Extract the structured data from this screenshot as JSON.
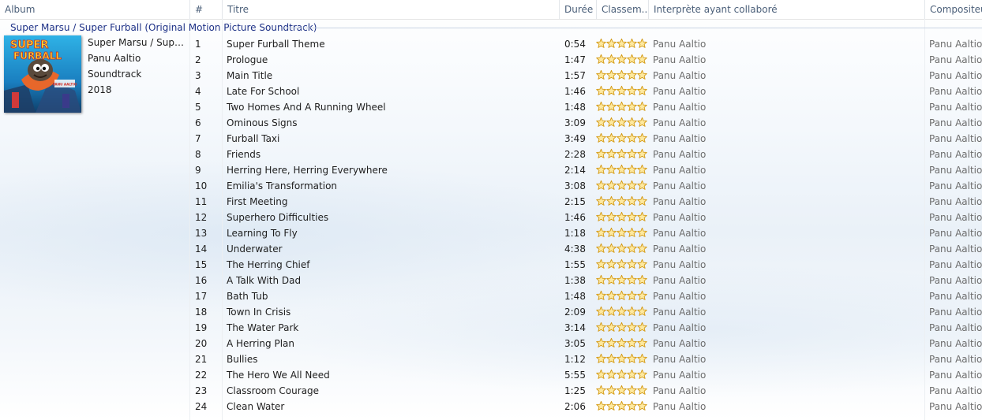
{
  "columns": {
    "album": "Album",
    "num": "#",
    "title": "Titre",
    "duration": "Durée",
    "rating": "Classem...",
    "artist": "Interprète ayant collaboré",
    "composer": "Compositeur"
  },
  "group": {
    "title": "Super Marsu / Super Furball (Original Motion Picture Soundtrack)",
    "album_short": "Super Marsu / Super F...",
    "artist": "Panu Aaltio",
    "genre": "Soundtrack",
    "year": "2018"
  },
  "cover": {
    "text1": "SUPER",
    "text2": "FURBALL",
    "credit": "PANU AALTIO"
  },
  "tracks": [
    {
      "num": "1",
      "title": "Super Furball Theme",
      "duration": "0:54",
      "artist": "Panu Aaltio",
      "composer": "Panu Aaltio"
    },
    {
      "num": "2",
      "title": "Prologue",
      "duration": "1:47",
      "artist": "Panu Aaltio",
      "composer": "Panu Aaltio"
    },
    {
      "num": "3",
      "title": "Main Title",
      "duration": "1:57",
      "artist": "Panu Aaltio",
      "composer": "Panu Aaltio"
    },
    {
      "num": "4",
      "title": "Late For School",
      "duration": "1:46",
      "artist": "Panu Aaltio",
      "composer": "Panu Aaltio"
    },
    {
      "num": "5",
      "title": "Two Homes And A Running Wheel",
      "duration": "1:48",
      "artist": "Panu Aaltio",
      "composer": "Panu Aaltio"
    },
    {
      "num": "6",
      "title": "Ominous Signs",
      "duration": "3:09",
      "artist": "Panu Aaltio",
      "composer": "Panu Aaltio"
    },
    {
      "num": "7",
      "title": "Furball Taxi",
      "duration": "3:49",
      "artist": "Panu Aaltio",
      "composer": "Panu Aaltio"
    },
    {
      "num": "8",
      "title": "Friends",
      "duration": "2:28",
      "artist": "Panu Aaltio",
      "composer": "Panu Aaltio"
    },
    {
      "num": "9",
      "title": "Herring Here, Herring Everywhere",
      "duration": "2:14",
      "artist": "Panu Aaltio",
      "composer": "Panu Aaltio"
    },
    {
      "num": "10",
      "title": "Emilia's Transformation",
      "duration": "3:08",
      "artist": "Panu Aaltio",
      "composer": "Panu Aaltio"
    },
    {
      "num": "11",
      "title": "First Meeting",
      "duration": "2:15",
      "artist": "Panu Aaltio",
      "composer": "Panu Aaltio"
    },
    {
      "num": "12",
      "title": "Superhero Difficulties",
      "duration": "1:46",
      "artist": "Panu Aaltio",
      "composer": "Panu Aaltio"
    },
    {
      "num": "13",
      "title": "Learning To Fly",
      "duration": "1:18",
      "artist": "Panu Aaltio",
      "composer": "Panu Aaltio"
    },
    {
      "num": "14",
      "title": "Underwater",
      "duration": "4:38",
      "artist": "Panu Aaltio",
      "composer": "Panu Aaltio"
    },
    {
      "num": "15",
      "title": "The Herring Chief",
      "duration": "1:55",
      "artist": "Panu Aaltio",
      "composer": "Panu Aaltio"
    },
    {
      "num": "16",
      "title": "A Talk With Dad",
      "duration": "1:38",
      "artist": "Panu Aaltio",
      "composer": "Panu Aaltio"
    },
    {
      "num": "17",
      "title": "Bath Tub",
      "duration": "1:48",
      "artist": "Panu Aaltio",
      "composer": "Panu Aaltio"
    },
    {
      "num": "18",
      "title": "Town In Crisis",
      "duration": "2:09",
      "artist": "Panu Aaltio",
      "composer": "Panu Aaltio"
    },
    {
      "num": "19",
      "title": "The Water Park",
      "duration": "3:14",
      "artist": "Panu Aaltio",
      "composer": "Panu Aaltio"
    },
    {
      "num": "20",
      "title": "A Herring Plan",
      "duration": "3:05",
      "artist": "Panu Aaltio",
      "composer": "Panu Aaltio"
    },
    {
      "num": "21",
      "title": "Bullies",
      "duration": "1:12",
      "artist": "Panu Aaltio",
      "composer": "Panu Aaltio"
    },
    {
      "num": "22",
      "title": "The Hero We All Need",
      "duration": "5:55",
      "artist": "Panu Aaltio",
      "composer": "Panu Aaltio"
    },
    {
      "num": "23",
      "title": "Classroom Courage",
      "duration": "1:25",
      "artist": "Panu Aaltio",
      "composer": "Panu Aaltio"
    },
    {
      "num": "24",
      "title": "Clean Water",
      "duration": "2:06",
      "artist": "Panu Aaltio",
      "composer": "Panu Aaltio"
    }
  ],
  "rating_max": 5,
  "rating_value": 0,
  "colors": {
    "star_fill": "#fde9a0",
    "star_stroke": "#d49a16",
    "group_title": "#1e3287",
    "muted_text": "#6d6d6d",
    "header_text": "#4c607a"
  }
}
